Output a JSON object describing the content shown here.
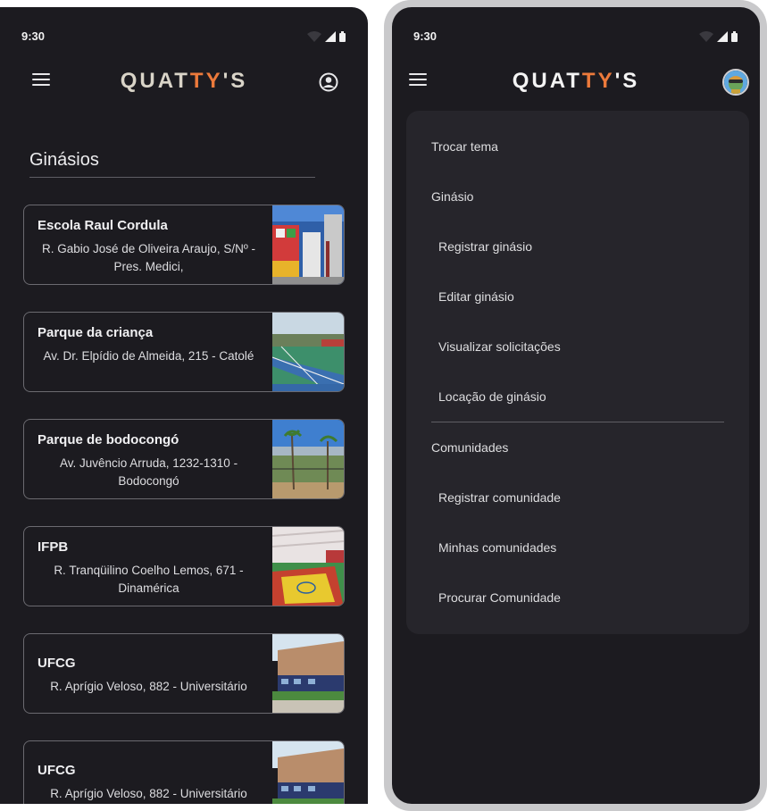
{
  "status_bar": {
    "time": "9:30"
  },
  "app_bar": {
    "logo_prefix": "QUAT",
    "logo_accent": "TY",
    "logo_suffix": "'S"
  },
  "gyms_screen": {
    "title": "Ginásios",
    "cards": [
      {
        "name": "Escola Raul Cordula",
        "address": "R. Gabio José de Oliveira Araujo, S/Nº - Pres. Medici,"
      },
      {
        "name": "Parque da criança",
        "address": "Av. Dr. Elpídio de Almeida, 215 - Catolé"
      },
      {
        "name": "Parque de bodocongó",
        "address": "Av. Juvêncio Arruda, 1232-1310 - Bodocongó"
      },
      {
        "name": "IFPB",
        "address": "R. Tranqüilino Coelho Lemos, 671 - Dinamérica"
      },
      {
        "name": "UFCG",
        "address": "R. Aprígio Veloso, 882 - Universitário"
      },
      {
        "name": "UFCG",
        "address": "R. Aprígio Veloso, 882 - Universitário"
      }
    ]
  },
  "menu_screen": {
    "items": {
      "change_theme": "Trocar tema",
      "gym_section": "Ginásio",
      "register_gym": "Registrar ginásio",
      "edit_gym": "Editar ginásio",
      "view_requests": "Visualizar solicitações",
      "rent_gym": "Locação de ginásio",
      "communities_section": "Comunidades",
      "register_community": "Registrar comunidade",
      "my_communities": "Minhas comunidades",
      "search_community": "Procurar Comunidade"
    }
  },
  "colors": {
    "background": "#1c1b20",
    "panel": "#26252b",
    "accent": "#ec7a3b",
    "logo": "#d9d4c8"
  }
}
